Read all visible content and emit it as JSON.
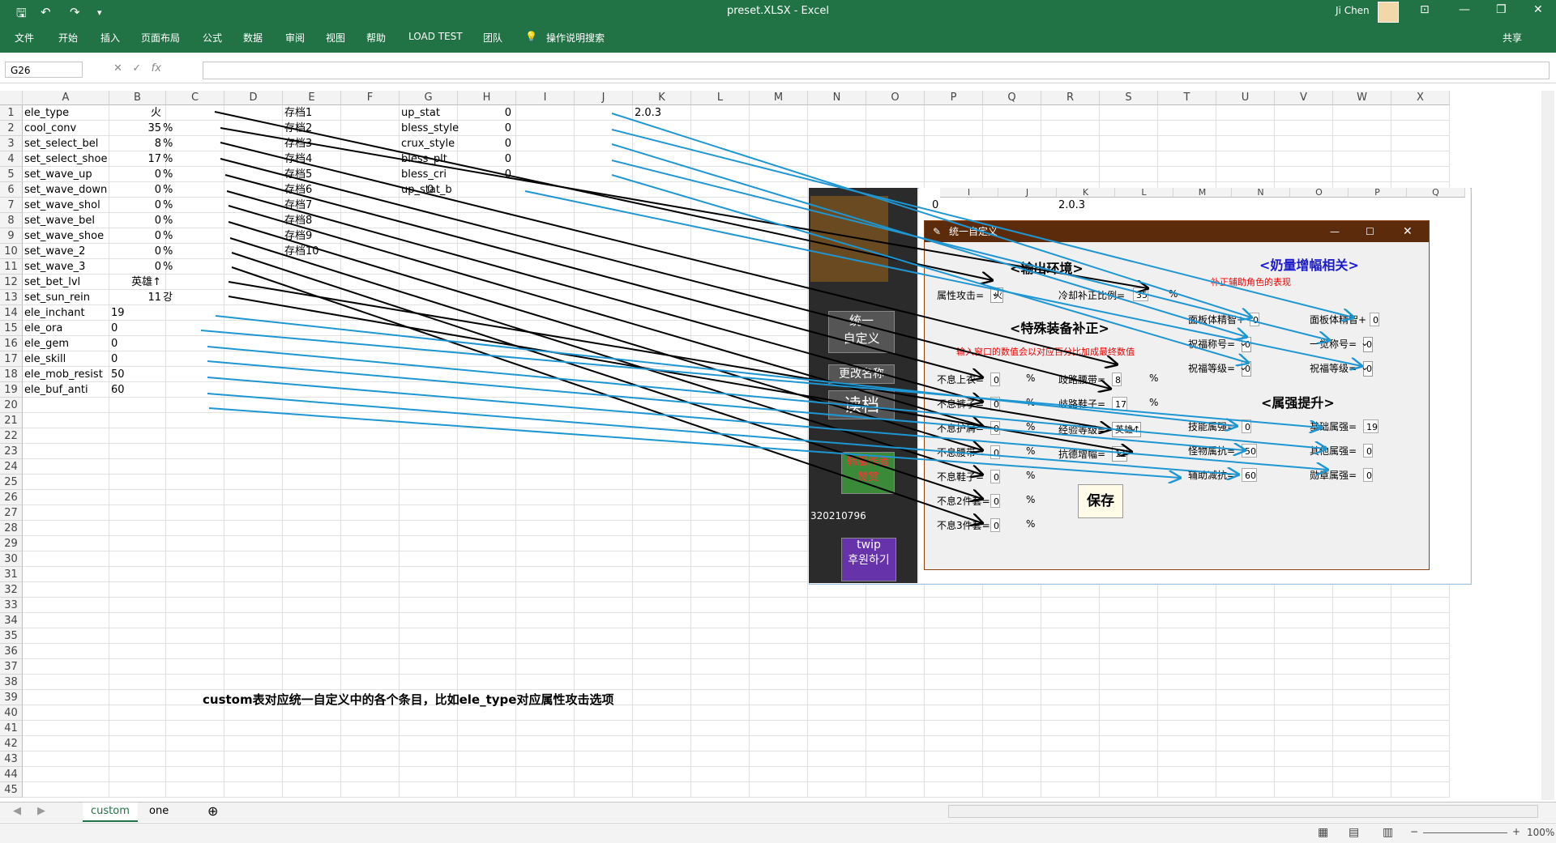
{
  "window": {
    "title": "preset.XLSX  -  Excel",
    "user": "Ji Chen",
    "share": "共享"
  },
  "menu": [
    "文件",
    "开始",
    "插入",
    "页面布局",
    "公式",
    "数据",
    "审阅",
    "视图",
    "帮助",
    "LOAD TEST",
    "团队",
    "操作说明搜索"
  ],
  "namebox": "G26",
  "columns": [
    "A",
    "B",
    "C",
    "D",
    "E",
    "F",
    "G",
    "H",
    "I",
    "J",
    "K",
    "L",
    "M",
    "N",
    "O",
    "P",
    "Q",
    "R",
    "S",
    "T",
    "U",
    "V",
    "W",
    "X"
  ],
  "rows_count": 45,
  "colA": [
    "ele_type",
    "cool_conv",
    "set_select_bel",
    "set_select_shoe",
    "set_wave_up",
    "set_wave_down",
    "set_wave_shol",
    "set_wave_bel",
    "set_wave_shoe",
    "set_wave_2",
    "set_wave_3",
    "set_bet_lvl",
    "set_sun_rein",
    "ele_inchant",
    "ele_ora",
    "ele_gem",
    "ele_skill",
    "ele_mob_resist",
    "ele_buf_anti"
  ],
  "colB": [
    "火",
    "35",
    "8",
    "17",
    "0",
    "0",
    "0",
    "0",
    "0",
    "0",
    "0",
    "英雄↑",
    "11",
    "19",
    "0",
    "0",
    "0",
    "50",
    "60"
  ],
  "colB_left": [
    false,
    false,
    false,
    false,
    false,
    false,
    false,
    false,
    false,
    false,
    false,
    false,
    false,
    true,
    true,
    true,
    true,
    true,
    true
  ],
  "colC": [
    "",
    "%",
    "%",
    "%",
    "%",
    "%",
    "%",
    "%",
    "%",
    "%",
    "%",
    "",
    "강",
    "",
    "",
    "",
    "",
    "",
    ""
  ],
  "colE": [
    "存档1",
    "存档2",
    "存档3",
    "存档4",
    "存档5",
    "存档6",
    "存档7",
    "存档8",
    "存档9",
    "存档10"
  ],
  "colG": [
    "up_stat",
    "bless_style",
    "crux_style",
    "bless_plt",
    "bless_cri",
    "up_stat_b"
  ],
  "colH": [
    "0",
    "0",
    "0",
    "0",
    "0",
    "0"
  ],
  "K1": "2.0.3",
  "caption": "custom表对应统一自定义中的各个条目，比如ele_type对应属性攻击选项",
  "sheets": [
    "custom",
    "one"
  ],
  "zoom": "100%",
  "overlay": {
    "grid_cols": [
      "I",
      "J",
      "K",
      "L",
      "M",
      "N",
      "O",
      "P",
      "Q"
    ],
    "grid_val_0": "0",
    "grid_val_ver": "2.0.3",
    "sidebar": {
      "btn1": "统一\n自定义",
      "btn2": "更改名称",
      "btn3": "读档",
      "banner": "韩服作者\n赞赏",
      "code": "320210796",
      "twip": "twip\n후원하기"
    },
    "dialog": {
      "title": "统一自定义",
      "sec_output": "<输出环境>",
      "sec_special": "<特殊装备补正>",
      "sec_buff": "<奶量增幅相关>",
      "sec_ele": "<属强提升>",
      "note_buff": "补正辅助角色的表现",
      "note_special": "输入窗口的数值会以对应百分比加成最终数值",
      "attr_label": "属性攻击=",
      "attr_val": "火",
      "cool_label": "冷却补正比例=",
      "cool_val": "35",
      "pct": "%",
      "special_left": [
        [
          "不息上衣=",
          "0"
        ],
        [
          "不息裤子=",
          "0"
        ],
        [
          "不息护肩=",
          "0"
        ],
        [
          "不息腰带=",
          "0"
        ],
        [
          "不息鞋子=",
          "0"
        ],
        [
          "不息2件套=",
          "0"
        ],
        [
          "不息3件套=",
          "0"
        ]
      ],
      "special_right": [
        [
          "歧路腰带=",
          "8"
        ],
        [
          "歧路鞋子=",
          "17"
        ]
      ],
      "bet_label": "经验等级=",
      "bet_val": "英雄↑",
      "sun_label": "抗德增幅=",
      "sun_val": "11",
      "buff_left": [
        [
          "面板体精智+",
          "0"
        ],
        [
          "祝福称号=",
          "0"
        ],
        [
          "祝福等级=",
          "0"
        ]
      ],
      "buff_right": [
        [
          "面板体精智+",
          "0"
        ],
        [
          "一觉称号=",
          "0"
        ],
        [
          "祝福等级=",
          "0"
        ]
      ],
      "ele_left": [
        [
          "技能属强=",
          "0"
        ],
        [
          "怪物属抗=",
          "50"
        ],
        [
          "辅助减抗=",
          "60"
        ]
      ],
      "ele_right": [
        [
          "基础属强=",
          "19"
        ],
        [
          "其他属强=",
          "0"
        ],
        [
          "勋章属强=",
          "0"
        ]
      ],
      "save": "保存"
    }
  },
  "colors": {
    "excel_green": "#217346",
    "blue_arrow": "#1e96d2",
    "black_arrow": "#000000",
    "dlg_header": "#5b2b0c"
  }
}
